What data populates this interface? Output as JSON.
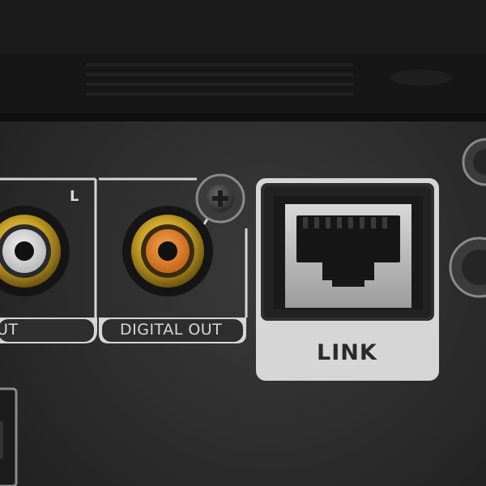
{
  "panel": {
    "channel_label": "L",
    "analog_out_label_fragment": "UT",
    "digital_out_label": "DIGITAL OUT",
    "link_label": "LINK"
  },
  "colors": {
    "panel": "#2e2e2e",
    "gold": "#c9a227",
    "rca_white_insulator": "#d9d9d9",
    "rca_orange_insulator": "#e0801e",
    "label_frame": "#d6d6d6"
  }
}
